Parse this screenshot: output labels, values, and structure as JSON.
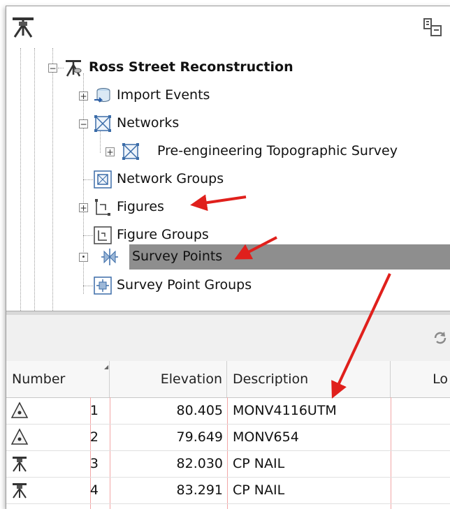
{
  "toolbar": {
    "left_icon": "survey-database-icon",
    "right_icon": "panel-toggle-icon"
  },
  "tree": {
    "root": {
      "label": "Ross Street Reconstruction",
      "icon": "survey-database-icon",
      "expander": "−"
    },
    "items": [
      {
        "label": "Import Events",
        "icon": "import-events-icon",
        "expander": "+"
      },
      {
        "label": "Networks",
        "icon": "network-icon",
        "expander": "−"
      },
      {
        "label": "Pre-engineering Topographic Survey",
        "icon": "network-icon",
        "expander": "+"
      },
      {
        "label": "Network Groups",
        "icon": "network-groups-icon",
        "expander": ""
      },
      {
        "label": "Figures",
        "icon": "figures-icon",
        "expander": "+"
      },
      {
        "label": "Figure Groups",
        "icon": "figure-groups-icon",
        "expander": ""
      },
      {
        "label": "Survey Points",
        "icon": "survey-points-icon",
        "expander": "•"
      },
      {
        "label": "Survey Point Groups",
        "icon": "survey-point-groups-icon",
        "expander": ""
      }
    ]
  },
  "grid": {
    "columns": [
      "Number",
      "Elevation",
      "Description",
      "Lo"
    ],
    "rows": [
      {
        "icon": "control-point-icon",
        "number": "1",
        "elevation": "80.405",
        "description": "MONV4116UTM"
      },
      {
        "icon": "control-point-icon",
        "number": "2",
        "elevation": "79.649",
        "description": "MONV654"
      },
      {
        "icon": "instrument-tripod-icon",
        "number": "3",
        "elevation": "82.030",
        "description": "CP NAIL"
      },
      {
        "icon": "instrument-tripod-icon",
        "number": "4",
        "elevation": "83.291",
        "description": "CP NAIL"
      }
    ]
  },
  "colors": {
    "selection": "#8e8e8e",
    "arrow": "#e0201c",
    "grid_line": "#f2a6a6"
  }
}
